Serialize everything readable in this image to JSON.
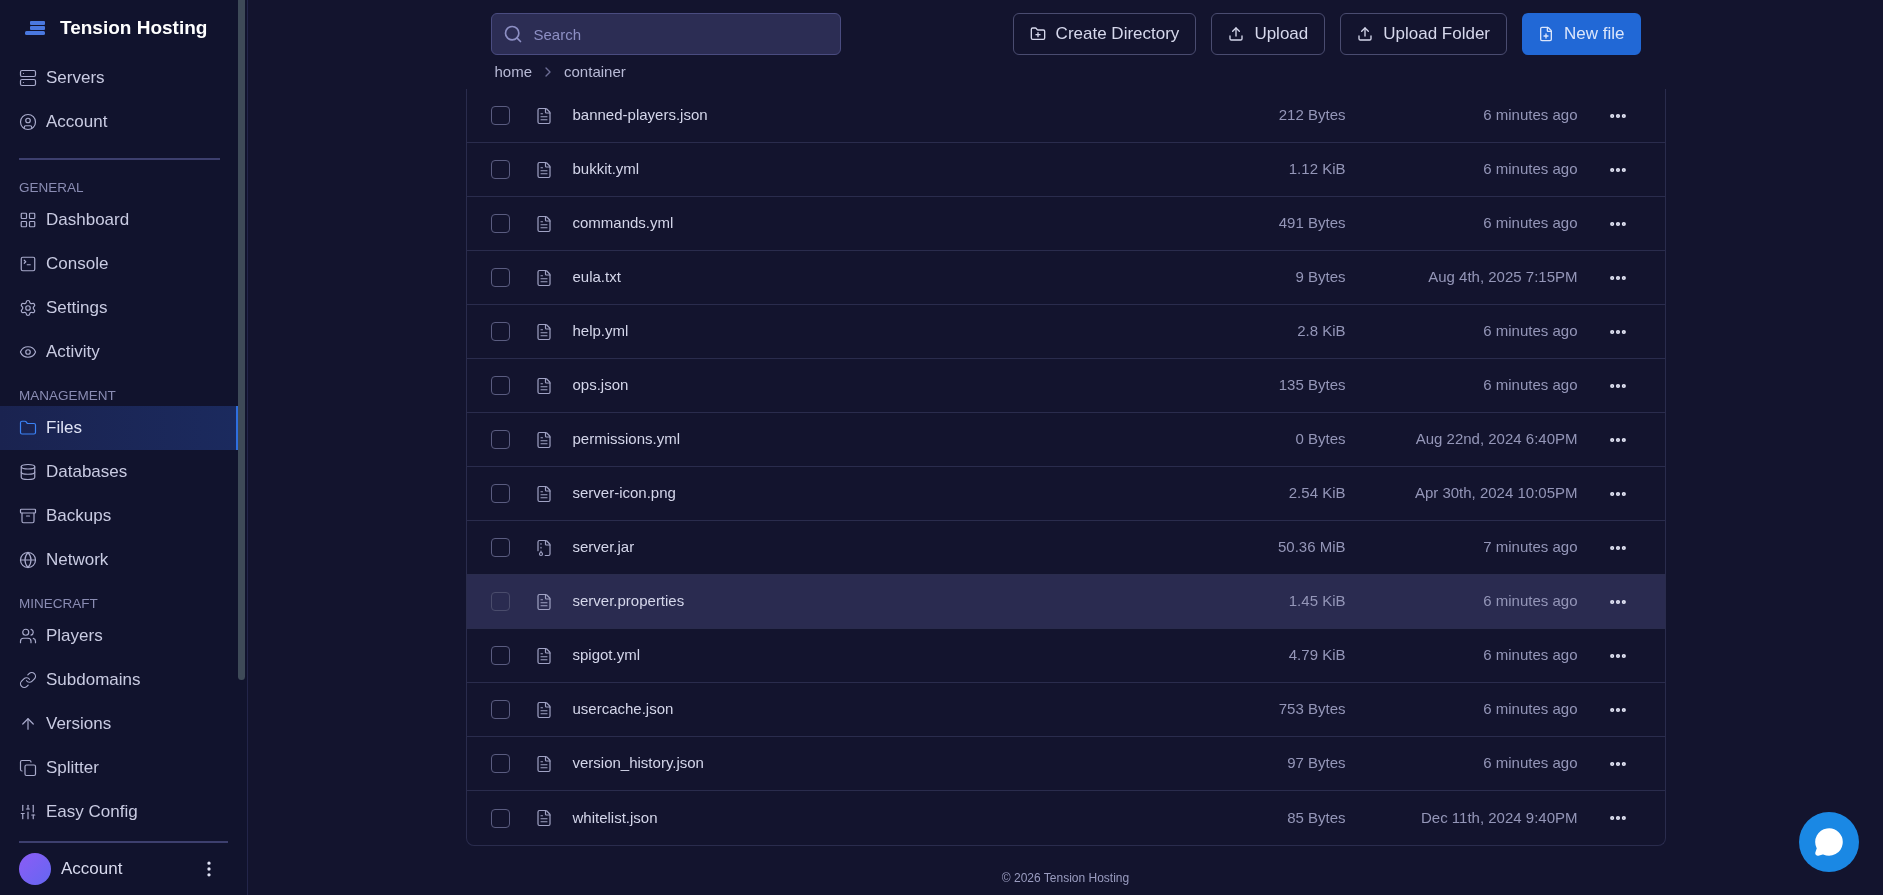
{
  "brand": {
    "name": "Tension Hosting"
  },
  "sidebar": {
    "top_items": [
      {
        "label": "Servers",
        "selected": false
      },
      {
        "label": "Account",
        "selected": false
      }
    ],
    "sections": [
      {
        "heading": "GENERAL",
        "items": [
          {
            "label": "Dashboard",
            "selected": false
          },
          {
            "label": "Console",
            "selected": false
          },
          {
            "label": "Settings",
            "selected": false
          },
          {
            "label": "Activity",
            "selected": false
          }
        ]
      },
      {
        "heading": "MANAGEMENT",
        "items": [
          {
            "label": "Files",
            "selected": true
          },
          {
            "label": "Databases",
            "selected": false
          },
          {
            "label": "Backups",
            "selected": false
          },
          {
            "label": "Network",
            "selected": false
          }
        ]
      },
      {
        "heading": "MINECRAFT",
        "items": [
          {
            "label": "Players",
            "selected": false
          },
          {
            "label": "Subdomains",
            "selected": false
          },
          {
            "label": "Versions",
            "selected": false
          },
          {
            "label": "Splitter",
            "selected": false
          },
          {
            "label": "Easy Config",
            "selected": false
          }
        ]
      }
    ],
    "footer": {
      "label": "Account"
    }
  },
  "toolbar": {
    "search": {
      "placeholder": "Search"
    },
    "buttons": [
      {
        "label": "Create Directory",
        "kind": "folder"
      },
      {
        "label": "Upload",
        "kind": "upload"
      },
      {
        "label": "Upload Folder",
        "kind": "upload"
      },
      {
        "label": "New file",
        "kind": "primary"
      }
    ]
  },
  "breadcrumb": [
    "home",
    "container"
  ],
  "files": [
    {
      "name": "banned-players.json",
      "kind": "text",
      "size": "212 Bytes",
      "modified": "6 minutes ago",
      "checked": false,
      "selected": false
    },
    {
      "name": "bukkit.yml",
      "kind": "text",
      "size": "1.12 KiB",
      "modified": "6 minutes ago",
      "checked": false,
      "selected": false
    },
    {
      "name": "commands.yml",
      "kind": "text",
      "size": "491 Bytes",
      "modified": "6 minutes ago",
      "checked": false,
      "selected": false
    },
    {
      "name": "eula.txt",
      "kind": "text",
      "size": "9 Bytes",
      "modified": "Aug 4th, 2025 7:15PM",
      "checked": false,
      "selected": false
    },
    {
      "name": "help.yml",
      "kind": "text",
      "size": "2.8 KiB",
      "modified": "6 minutes ago",
      "checked": false,
      "selected": false
    },
    {
      "name": "ops.json",
      "kind": "text",
      "size": "135 Bytes",
      "modified": "6 minutes ago",
      "checked": false,
      "selected": false
    },
    {
      "name": "permissions.yml",
      "kind": "text",
      "size": "0 Bytes",
      "modified": "Aug 22nd, 2024 6:40PM",
      "checked": false,
      "selected": false
    },
    {
      "name": "server-icon.png",
      "kind": "text",
      "size": "2.54 KiB",
      "modified": "Apr 30th, 2024 10:05PM",
      "checked": false,
      "selected": false
    },
    {
      "name": "server.jar",
      "kind": "archive",
      "size": "50.36 MiB",
      "modified": "7 minutes ago",
      "checked": false,
      "selected": false
    },
    {
      "name": "server.properties",
      "kind": "text",
      "size": "1.45 KiB",
      "modified": "6 minutes ago",
      "checked": false,
      "selected": true
    },
    {
      "name": "spigot.yml",
      "kind": "text",
      "size": "4.79 KiB",
      "modified": "6 minutes ago",
      "checked": false,
      "selected": false
    },
    {
      "name": "usercache.json",
      "kind": "text",
      "size": "753 Bytes",
      "modified": "6 minutes ago",
      "checked": false,
      "selected": false
    },
    {
      "name": "version_history.json",
      "kind": "text",
      "size": "97 Bytes",
      "modified": "6 minutes ago",
      "checked": false,
      "selected": false
    },
    {
      "name": "whitelist.json",
      "kind": "text",
      "size": "85 Bytes",
      "modified": "Dec 11th, 2024 9:40PM",
      "checked": false,
      "selected": false
    }
  ],
  "footer": "© 2026 Tension Hosting"
}
